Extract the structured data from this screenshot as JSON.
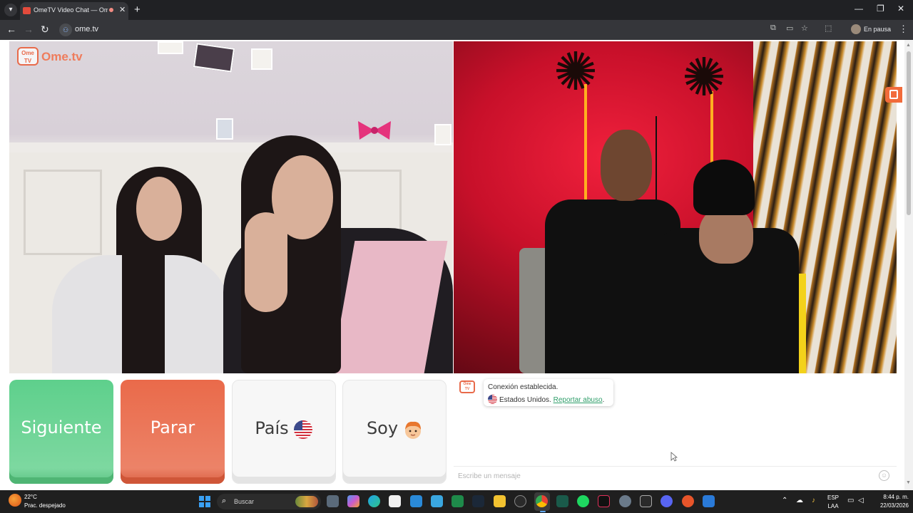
{
  "browser": {
    "tab_title": "OmeTV Video Chat — Ome",
    "tab_close": "✕",
    "new_tab": "+",
    "url": "ome.tv",
    "profile_status": "En pausa",
    "window_controls": [
      "—",
      "❐",
      "✕"
    ]
  },
  "page": {
    "logo_bubble": "Ome TV",
    "logo_text": "Ome.tv",
    "buttons": {
      "next_label": "Siguiente",
      "stop_label": "Parar",
      "country_label": "País",
      "gender_label": "Soy"
    },
    "country_flag_icon": "us-flag-icon",
    "gender_icon": "boy-emoji-icon",
    "chat": {
      "logo_text": "Ome TV",
      "connection_status": "Conexión establecida.",
      "country_text": "Estados Unidos.",
      "report_link": "Reportar abuso",
      "report_suffix": ".",
      "input_placeholder": "Escribe un mensaje",
      "emoji_glyph": "☺"
    }
  },
  "taskbar": {
    "weather_temp": "22°C",
    "weather_desc": "Prac. despejado",
    "search_placeholder": "Buscar",
    "language_top": "ESP",
    "language_bottom": "LAA",
    "time": "8:44 p. m.",
    "date": "22/03/2026"
  },
  "colors": {
    "next_green": "#5ed08c",
    "stop_red": "#ea6a4a",
    "brand_orange": "#ef7c5c",
    "report_link_green": "#2f9e6a"
  }
}
